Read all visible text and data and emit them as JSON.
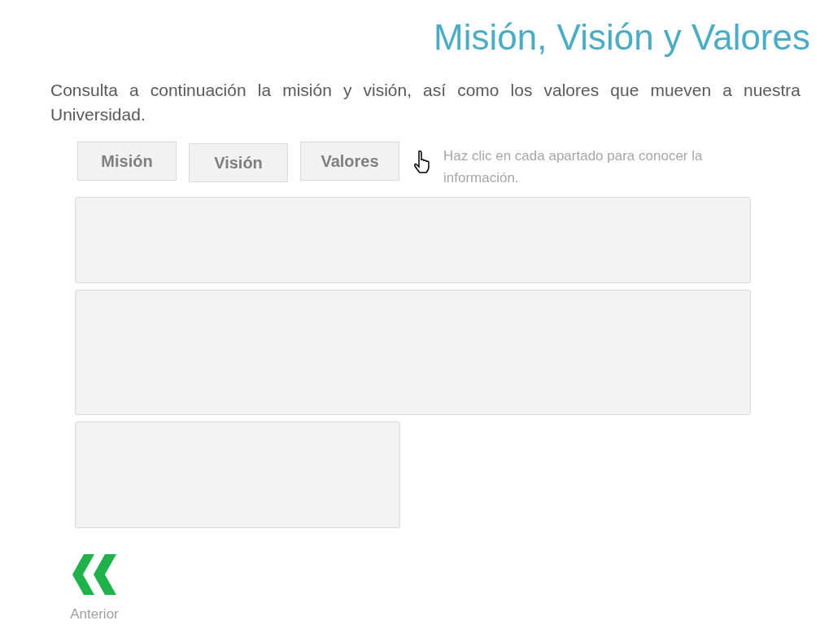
{
  "title": "Misión, Visión y Valores",
  "intro": "Consulta a continuación la misión y visión, así como los valores que mueven a nuestra Universidad.",
  "tabs": [
    {
      "label": "Misión"
    },
    {
      "label": "Visión"
    },
    {
      "label": "Valores"
    }
  ],
  "hint": "Haz clic en cada  apartado para conocer la información.",
  "nav": {
    "label": "Anterior"
  }
}
